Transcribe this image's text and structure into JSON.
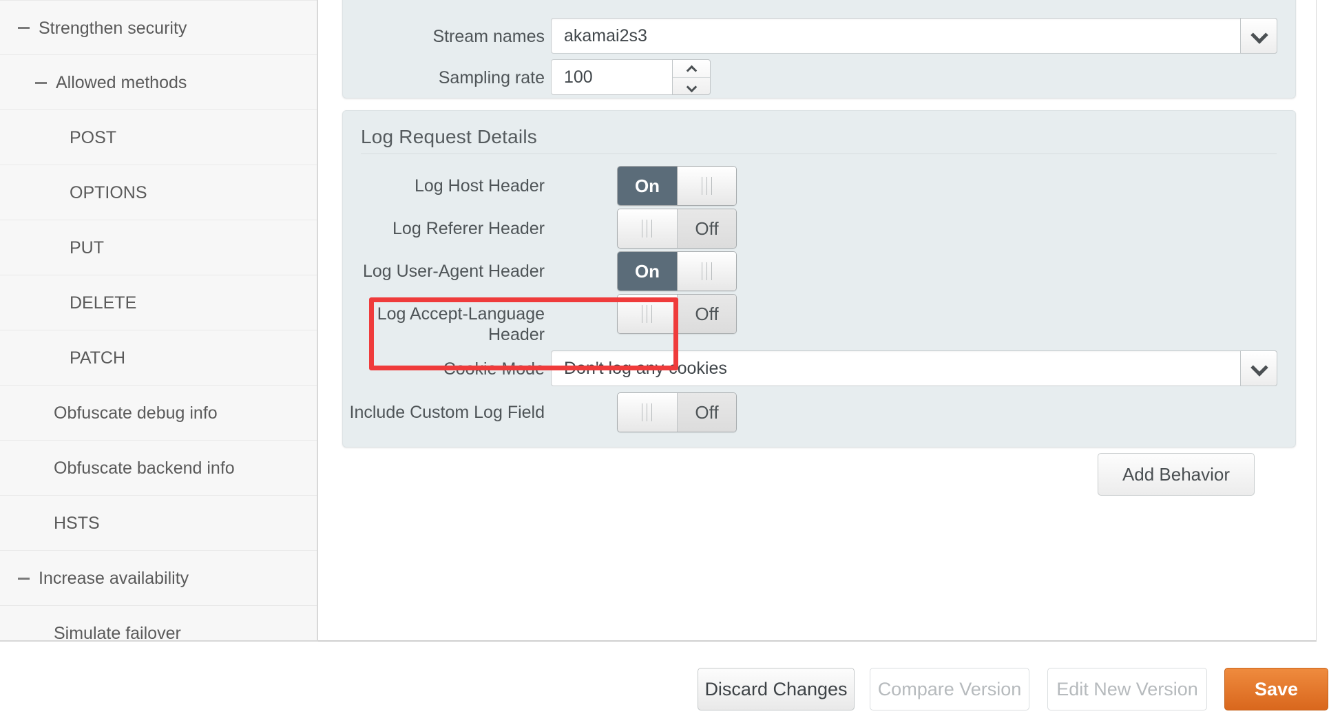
{
  "sidebar": {
    "items": [
      {
        "label": "Strengthen security",
        "level": 0,
        "expander": "minus-icon"
      },
      {
        "label": "Allowed methods",
        "level": 1,
        "expander": "minus-icon"
      },
      {
        "label": "POST",
        "level": 2,
        "expander": null
      },
      {
        "label": "OPTIONS",
        "level": 2,
        "expander": null
      },
      {
        "label": "PUT",
        "level": 2,
        "expander": null
      },
      {
        "label": "DELETE",
        "level": 2,
        "expander": null
      },
      {
        "label": "PATCH",
        "level": 2,
        "expander": null
      },
      {
        "label": "Obfuscate debug info",
        "level": 1,
        "expander": null
      },
      {
        "label": "Obfuscate backend info",
        "level": 1,
        "expander": null
      },
      {
        "label": "HSTS",
        "level": 1,
        "expander": null
      },
      {
        "label": "Increase availability",
        "level": 0,
        "expander": "minus-icon"
      },
      {
        "label": "Simulate failover",
        "level": 1,
        "expander": null
      }
    ]
  },
  "top_panel": {
    "stream_names": {
      "label": "Stream names",
      "value": "akamai2s3",
      "control": "select",
      "icon": "chevron-down-icon"
    },
    "sampling_rate": {
      "label": "Sampling rate",
      "value": "100",
      "control": "number-spinner",
      "icon_up": "caret-up-icon",
      "icon_down": "caret-down-icon"
    }
  },
  "log_panel": {
    "title": "Log Request Details",
    "toggles": [
      {
        "label": "Log Host Header",
        "state": "On",
        "on_label": "On",
        "off_label": "Off"
      },
      {
        "label": "Log Referer Header",
        "state": "Off",
        "on_label": "On",
        "off_label": "Off"
      },
      {
        "label": "Log User-Agent Header",
        "state": "On",
        "on_label": "On",
        "off_label": "Off",
        "highlighted": true
      },
      {
        "label": "Log Accept-Language Header",
        "state": "Off",
        "on_label": "On",
        "off_label": "Off",
        "wrap": true
      }
    ],
    "cookie_mode": {
      "label": "Cookie Mode",
      "value": "Don't log any cookies",
      "control": "select",
      "icon": "chevron-down-icon"
    },
    "include_custom_log_field": {
      "label": "Include Custom Log Field",
      "state": "Off",
      "on_label": "On",
      "off_label": "Off"
    }
  },
  "actions": {
    "add_behavior": "Add Behavior"
  },
  "footer": {
    "discard": "Discard Changes",
    "compare": "Compare Version",
    "edit_new": "Edit New Version",
    "save": "Save"
  },
  "colors": {
    "panel_bg": "#e7edef",
    "toggle_on": "#5b6c79",
    "save_button": "#e07a2c",
    "highlight": "#ef3b3b"
  }
}
